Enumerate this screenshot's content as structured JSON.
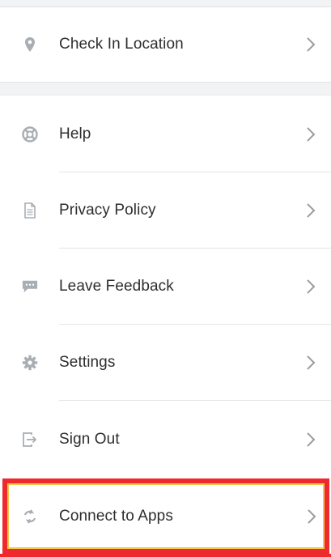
{
  "menu": {
    "check_in": {
      "label": "Check In Location",
      "icon": "location-pin-icon"
    },
    "items": [
      {
        "label": "Help",
        "icon": "lifebuoy-icon"
      },
      {
        "label": "Privacy Policy",
        "icon": "document-icon"
      },
      {
        "label": "Leave Feedback",
        "icon": "chat-bubble-icon"
      },
      {
        "label": "Settings",
        "icon": "gear-icon"
      },
      {
        "label": "Sign Out",
        "icon": "sign-out-icon"
      },
      {
        "label": "Connect to Apps",
        "icon": "sync-arrows-icon"
      }
    ]
  },
  "colors": {
    "icon_gray": "#a9aeb3",
    "chevron_gray": "#9b9b9b",
    "highlight_red": "#ee2a2f",
    "highlight_yellow": "#f5c84a"
  }
}
